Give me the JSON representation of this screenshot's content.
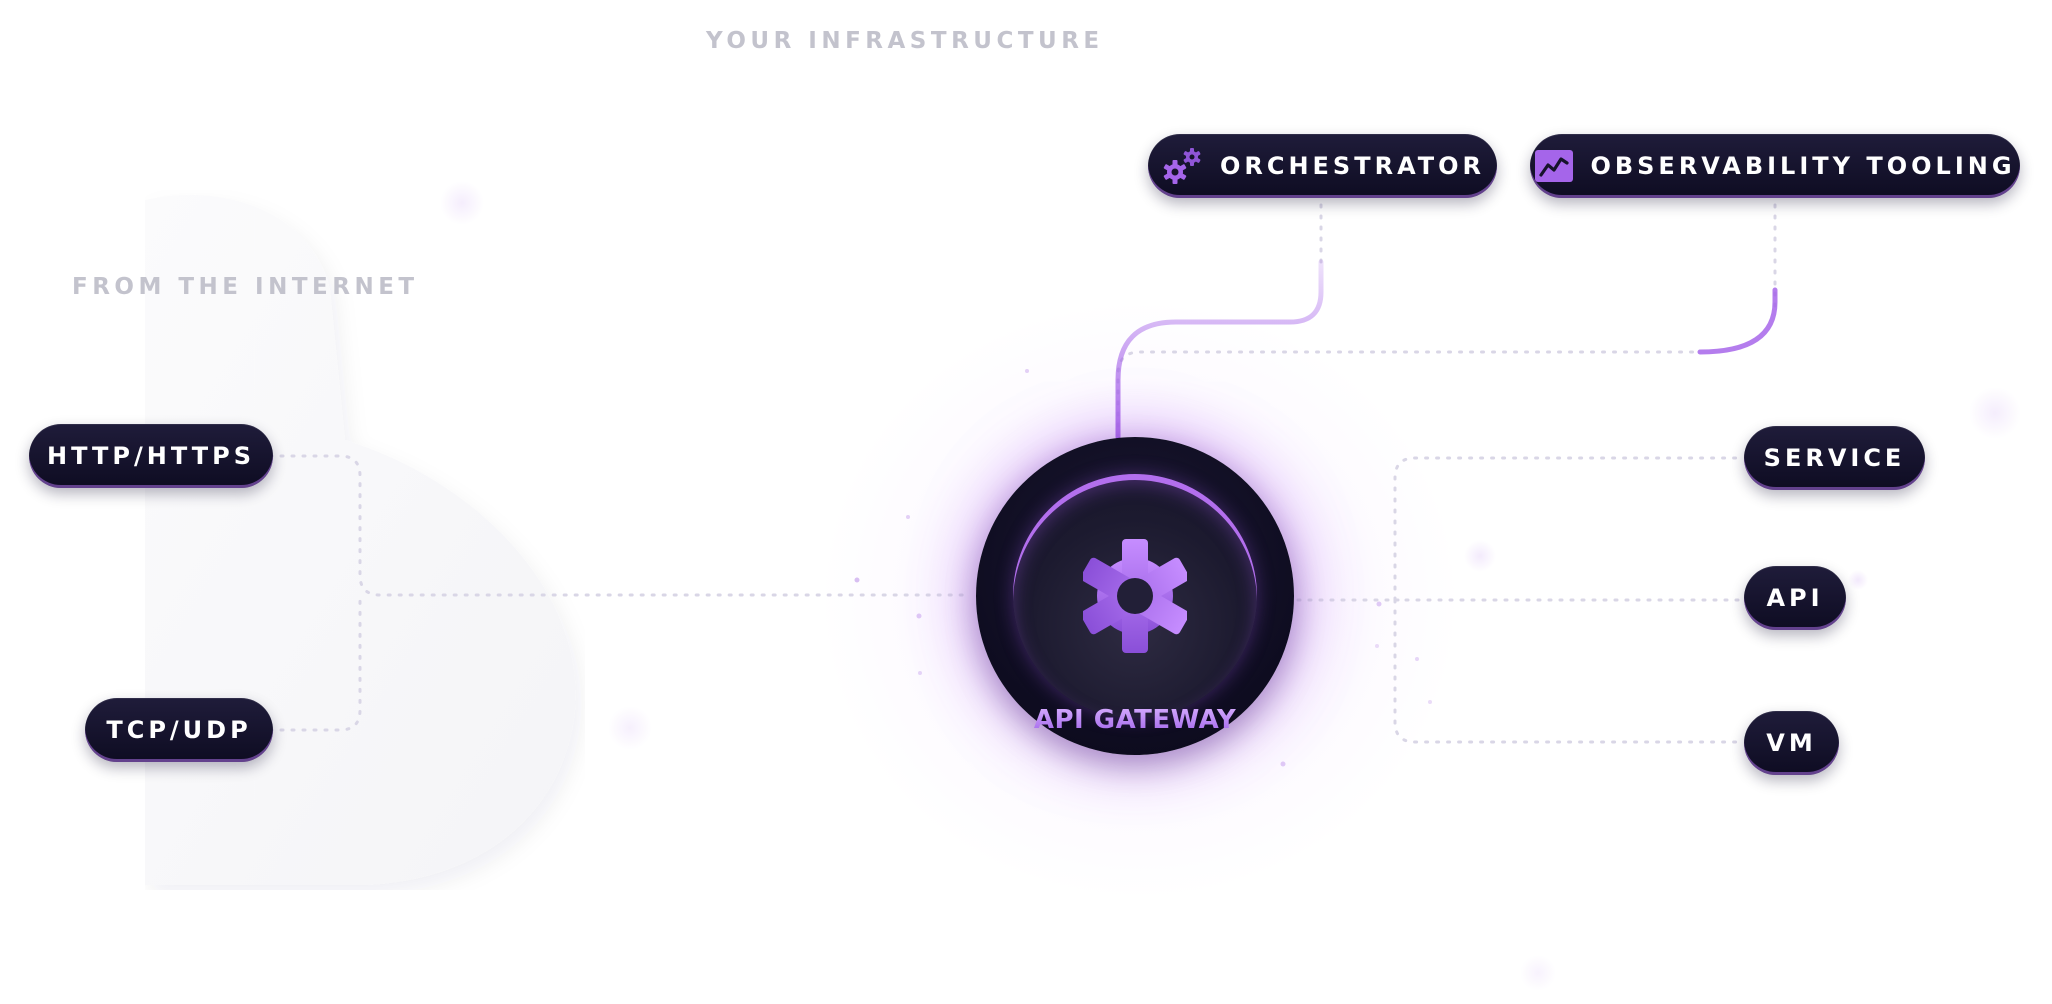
{
  "labels": {
    "infrastructure": "YOUR INFRASTRUCTURE",
    "internet": "FROM THE INTERNET"
  },
  "sources": {
    "http": "HTTP/HTTPS",
    "tcp": "TCP/UDP"
  },
  "gateway": {
    "label": "API GATEWAY",
    "icon": "gear-icon"
  },
  "tooling": {
    "orchestrator": {
      "label": "ORCHESTRATOR",
      "icon": "gears-icon"
    },
    "observability": {
      "label": "OBSERVABILITY TOOLING",
      "icon": "chart-line-icon"
    }
  },
  "targets": {
    "service": "SERVICE",
    "api": "API",
    "vm": "VM"
  },
  "colors": {
    "accent": "#a15ce8",
    "pill_background": "#14122a",
    "label_gray": "#c3c3cd"
  }
}
